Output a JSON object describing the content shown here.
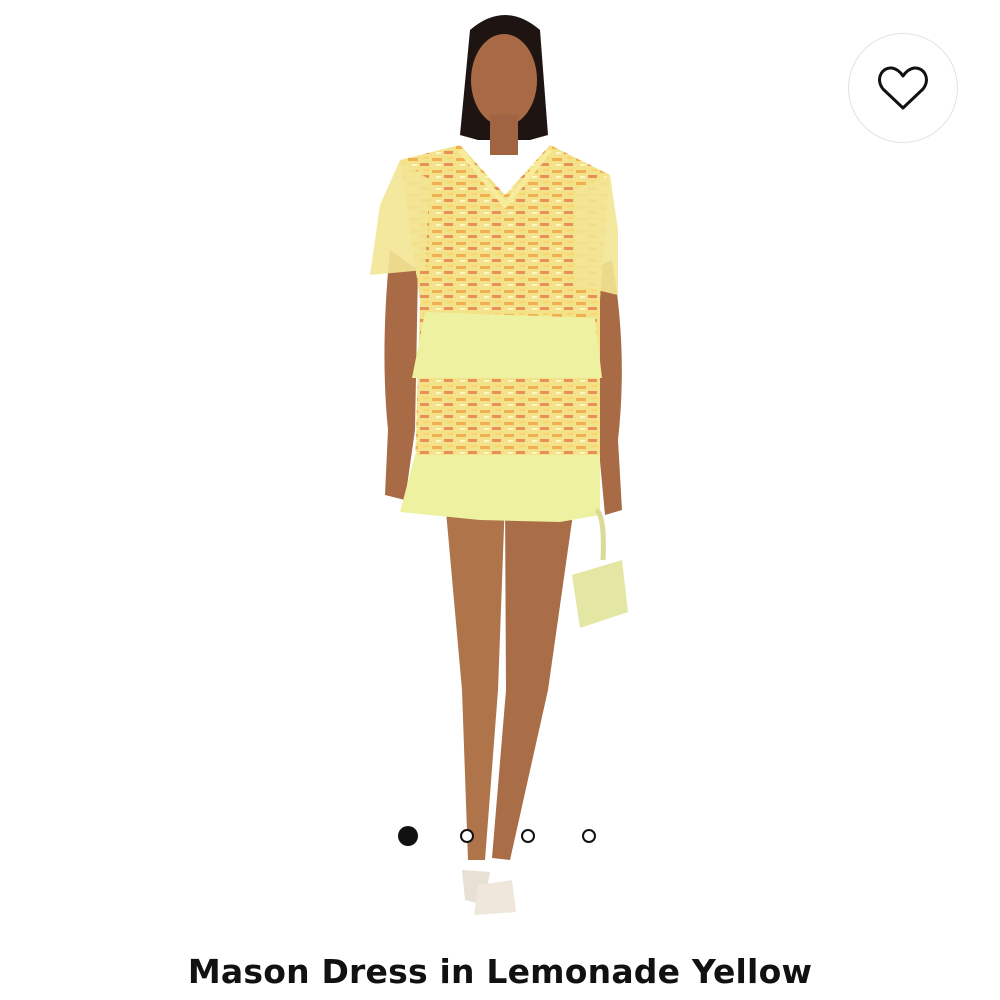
{
  "product": {
    "title": "Mason Dress in Lemonade Yellow"
  },
  "carousel": {
    "total": 4,
    "current": 1
  },
  "icons": {
    "favorite": "heart-icon"
  },
  "colors": {
    "dress": "#f3e58c",
    "ruffle": "#eeef9e",
    "sequin": "#f0a94c",
    "accent_text": "#111111"
  }
}
